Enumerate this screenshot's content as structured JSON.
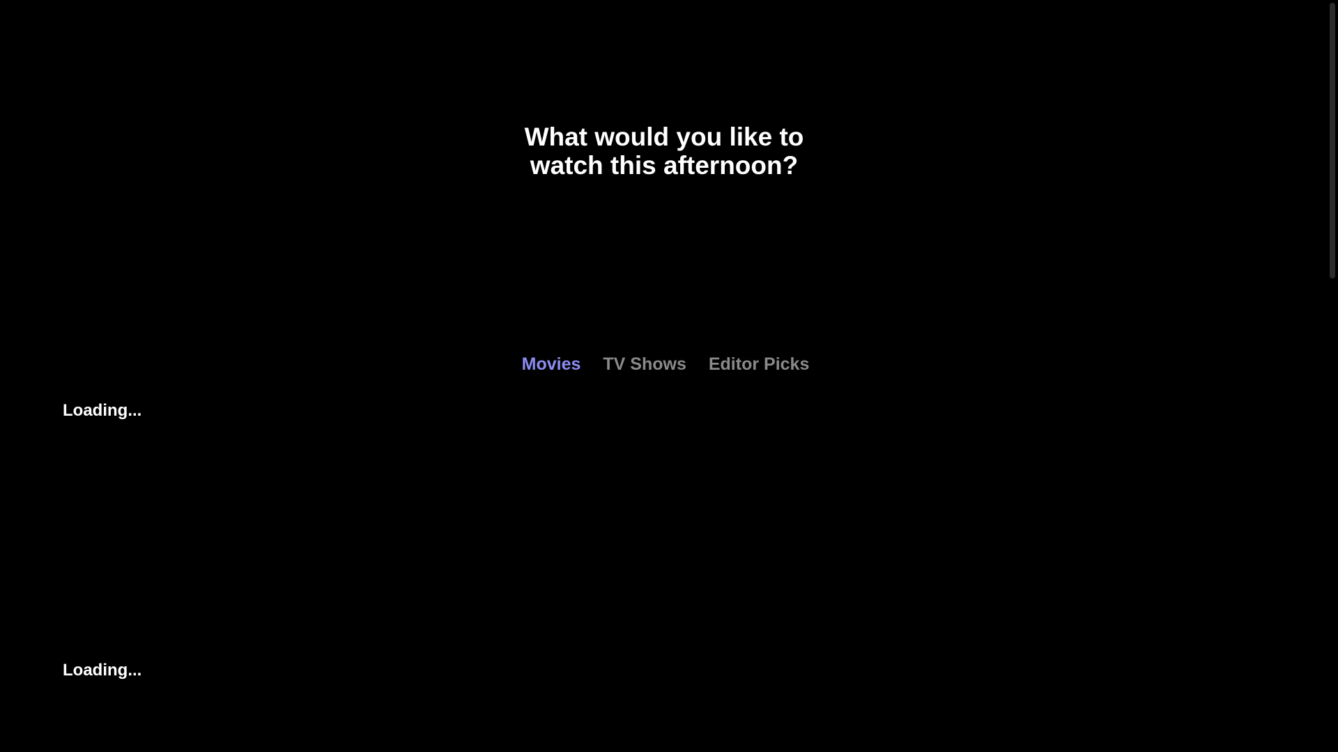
{
  "header": {
    "brand_line_1": "",
    "brand_line_2": "",
    "account_label": ""
  },
  "hero": {
    "title": "What would you like to watch this afternoon?"
  },
  "tabs": [
    {
      "label": "Movies",
      "active": true
    },
    {
      "label": "TV Shows",
      "active": false
    },
    {
      "label": "Editor Picks",
      "active": false
    }
  ],
  "sections": [
    {
      "status": "Loading..."
    },
    {
      "status": "Loading..."
    }
  ],
  "colors": {
    "background": "#000000",
    "active_tab": "#8c8cf2",
    "inactive_tab": "#8a8a8a",
    "text": "#ffffff"
  }
}
